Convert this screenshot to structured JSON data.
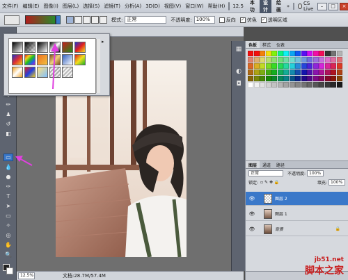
{
  "menubar": {
    "items": [
      "文件(F)",
      "编辑(E)",
      "图像(I)",
      "图层(L)",
      "选择(S)",
      "滤镜(T)",
      "分析(A)",
      "3D(D)",
      "视图(V)",
      "窗口(W)",
      "帮助(H)"
    ],
    "zoom": "12.5",
    "workspaces": [
      "基本功能",
      "设计",
      "绘画"
    ],
    "active_workspace": "设计",
    "more": "»",
    "cs_live": "CS Live"
  },
  "options": {
    "mode_label": "模式:",
    "mode_value": "正常",
    "opacity_label": "不透明度:",
    "opacity_value": "100%",
    "reverse": "反向",
    "dither": "仿色",
    "transparency": "透明区域"
  },
  "picker": {
    "menu_icon": "▸"
  },
  "status": {
    "zoom": "12.5%",
    "doc_info": "文档:28.7M/57.4M"
  },
  "panels": {
    "swatch_tabs": [
      "色板",
      "样式",
      "仪表"
    ],
    "layer_tabs": [
      "图层",
      "通道",
      "路径"
    ],
    "blend_mode": "正常",
    "opacity_label": "不透明度:",
    "opacity_value": "100%",
    "lock_label": "锁定:",
    "fill_label": "填充:",
    "fill_value": "100%"
  },
  "layers": [
    {
      "name": "图层 2",
      "selected": true
    },
    {
      "name": "图层 1",
      "selected": false
    },
    {
      "name": "背景",
      "selected": false
    }
  ],
  "watermark": {
    "url": "jb51.net",
    "name": "脚本之家"
  },
  "colors": {
    "accent": "#3a78c9",
    "annotation": "#e040e0"
  }
}
